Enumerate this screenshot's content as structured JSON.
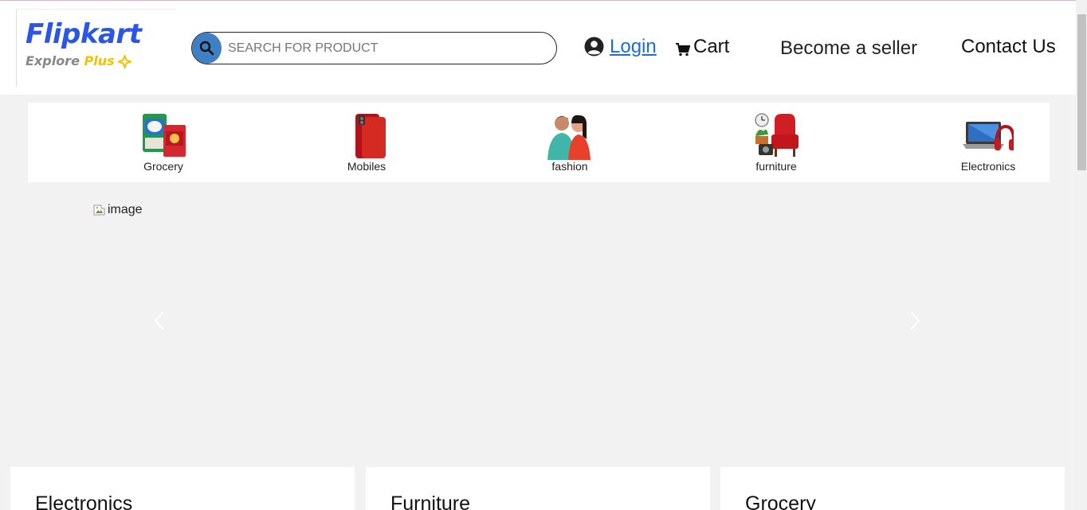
{
  "brand": {
    "name": "Flipkart",
    "tagline_a": "Explore",
    "tagline_b": "Plus",
    "color": "#2a55e5",
    "accent": "#f2c200"
  },
  "search": {
    "placeholder": "SEARCH FOR PRODUCT",
    "value": "",
    "icon": "search-icon"
  },
  "nav": {
    "login_label": "Login",
    "cart_label": "Cart",
    "seller_label": "Become a seller",
    "contact_label": "Contact Us"
  },
  "categories": [
    {
      "label": "Grocery",
      "icon": "grocery-icon"
    },
    {
      "label": "Mobiles",
      "icon": "mobile-icon"
    },
    {
      "label": "fashion",
      "icon": "fashion-icon"
    },
    {
      "label": "furniture",
      "icon": "furniture-icon"
    },
    {
      "label": "Electronics",
      "icon": "electronics-icon"
    }
  ],
  "banner": {
    "alt": "image"
  },
  "sections": [
    {
      "title": "Electronics"
    },
    {
      "title": "Furniture"
    },
    {
      "title": "Grocery"
    }
  ]
}
